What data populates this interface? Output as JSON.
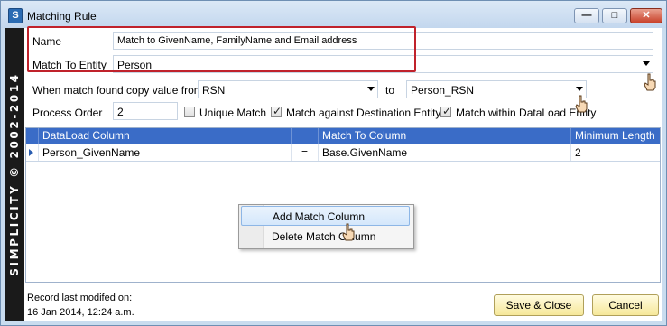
{
  "window": {
    "title": "Matching Rule",
    "icon_letter": "S"
  },
  "sidebar": {
    "text": "SIMPLICITY © 2002-2014"
  },
  "form": {
    "name_label": "Name",
    "name_value": "Match to GivenName, FamilyName and Email address",
    "entity_label": "Match To Entity",
    "entity_value": "Person",
    "copy_label": "When match found copy value from",
    "copy_from_value": "RSN",
    "to_label": "to",
    "copy_to_value": "Person_RSN",
    "order_label": "Process Order",
    "order_value": "2",
    "unique_match_label": "Unique Match",
    "unique_match_checked": false,
    "match_dest_label": "Match against Destination Entity",
    "match_dest_checked": true,
    "match_within_label": "Match within DataLoad Entity",
    "match_within_checked": true
  },
  "grid": {
    "headers": [
      "DataLoad Column",
      "",
      "Match To Column",
      "Minimum Length"
    ],
    "rows": [
      {
        "dataload_column": "Person_GivenName",
        "operator": "=",
        "match_to_column": "Base.GivenName",
        "minimum_length": "2"
      }
    ]
  },
  "context_menu": {
    "items": [
      {
        "label": "Add Match Column",
        "selected": true
      },
      {
        "label": "Delete Match Column",
        "selected": false
      }
    ]
  },
  "footer": {
    "modified_label": "Record last modifed on:",
    "modified_value": "16 Jan 2014, 12:24 a.m.",
    "save_close_label": "Save & Close",
    "cancel_label": "Cancel"
  },
  "colors": {
    "highlight_border": "#c0222b",
    "grid_header": "#3a6cc7",
    "button_fill": "#f6e89a"
  },
  "icons": [
    "app-icon",
    "minimize-icon",
    "maximize-icon",
    "close-icon",
    "dropdown-arrow-icon",
    "row-indicator-icon",
    "hand-cursor-icon"
  ]
}
